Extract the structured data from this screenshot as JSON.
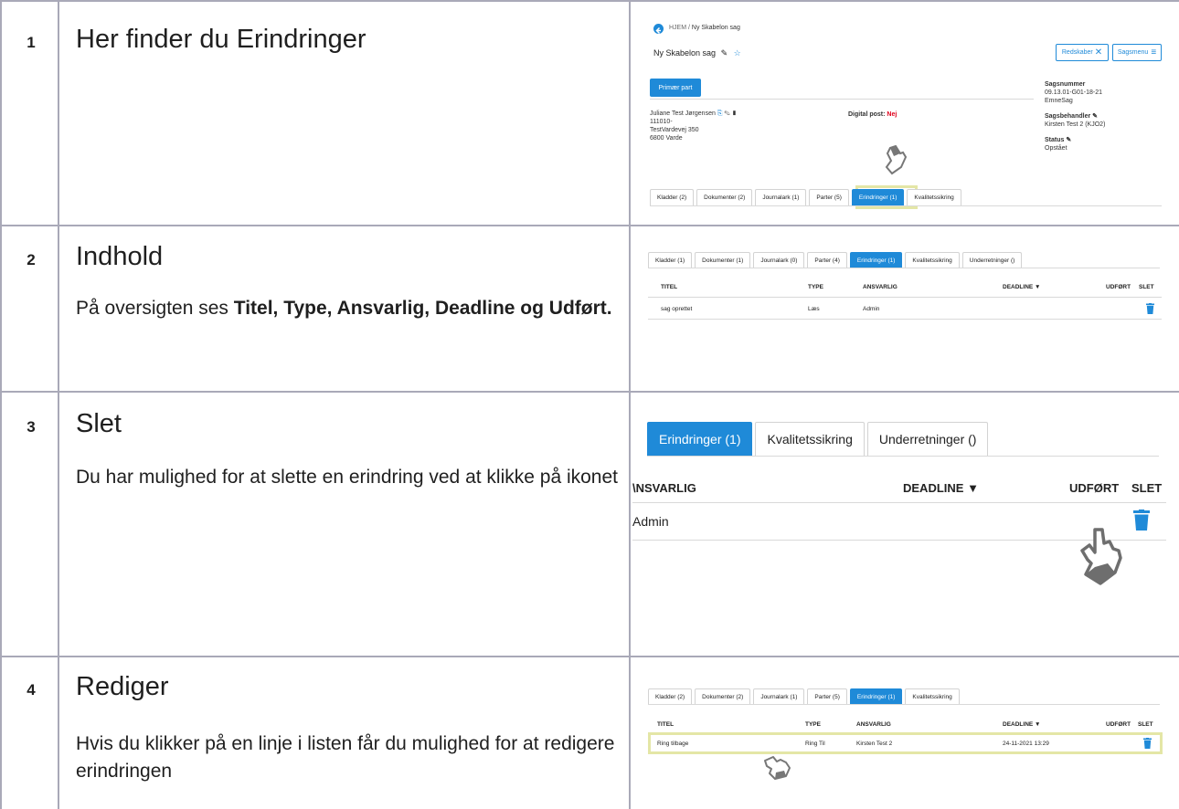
{
  "rows": [
    {
      "num": "1",
      "title": "Her finder du Erindringer",
      "desc": ""
    },
    {
      "num": "2",
      "title": "Indhold",
      "desc_prefix": "På oversigten ses ",
      "desc_bold": "Titel, Type, Ansvarlig, Deadline og Udført."
    },
    {
      "num": "3",
      "title": "Slet",
      "desc": "Du har mulighed for at slette en erindring ved at klikke på ikonet"
    },
    {
      "num": "4",
      "title": "Rediger",
      "desc": "Hvis du klikker på en linje i listen får du mulighed for at redigere erindringen"
    }
  ],
  "shot1": {
    "breadcrumb_home": "HJEM",
    "breadcrumb_sep": "/",
    "breadcrumb_current": "Ny Skabelon sag",
    "case_title": "Ny Skabelon sag",
    "redskaber": "Redskaber",
    "sagsmenu": "Sagsmenu",
    "primary_part_btn": "Primær part",
    "party_name": "Juliane Test Jørgensen",
    "party_cpr": "111010-",
    "party_address": "TestVardevej 350",
    "party_city": "6800 Varde",
    "digital_post_label": "Digital post:",
    "digital_post_value": "Nej",
    "sagsnummer_label": "Sagsnummer",
    "sagsnummer_value": "09.13.01-G01-18-21",
    "emne_value": "EmneSag",
    "sagsbehandler_label": "Sagsbehandler",
    "sagsbehandler_value": "Kirsten Test 2 (KJO2)",
    "status_label": "Status",
    "status_value": "Opstået",
    "tabs": [
      "Kladder (2)",
      "Dokumenter (2)",
      "Journalark (1)",
      "Parter (5)",
      "Erindringer (1)",
      "Kvalitetssikring"
    ]
  },
  "shot2": {
    "tabs": [
      "Kladder (1)",
      "Dokumenter (1)",
      "Journalark (0)",
      "Parter (4)",
      "Erindringer (1)",
      "Kvalitetssikring",
      "Underretninger ()"
    ],
    "headers": {
      "titel": "TITEL",
      "type": "TYPE",
      "ansvarlig": "ANSVARLIG",
      "deadline": "DEADLINE",
      "udfort": "UDFØRT",
      "slet": "SLET"
    },
    "row": {
      "titel": "sag oprettet",
      "type": "Læs",
      "ansvarlig": "Admin",
      "deadline": ""
    }
  },
  "shot3": {
    "tabs": [
      "Erindringer (1)",
      "Kvalitetssikring",
      "Underretninger ()"
    ],
    "headers": {
      "ansvarlig": "\\NSVARLIG",
      "deadline": "DEADLINE",
      "udfort": "UDFØRT",
      "slet": "SLET"
    },
    "row": {
      "ansvarlig": "Admin"
    }
  },
  "shot4": {
    "tabs": [
      "Kladder (2)",
      "Dokumenter (2)",
      "Journalark (1)",
      "Parter (5)",
      "Erindringer (1)",
      "Kvalitetssikring"
    ],
    "headers": {
      "titel": "TITEL",
      "type": "TYPE",
      "ansvarlig": "ANSVARLIG",
      "deadline": "DEADLINE",
      "udfort": "UDFØRT",
      "slet": "SLET"
    },
    "row": {
      "titel": "Ring tilbage",
      "type": "Ring Til",
      "ansvarlig": "Kirsten Test 2",
      "deadline": "24-11-2021 13:29"
    }
  },
  "colors": {
    "grid": "#a9a9b8",
    "accent": "#1f8ad8",
    "highlight": "#e4e6a6",
    "danger": "#e0001b"
  }
}
